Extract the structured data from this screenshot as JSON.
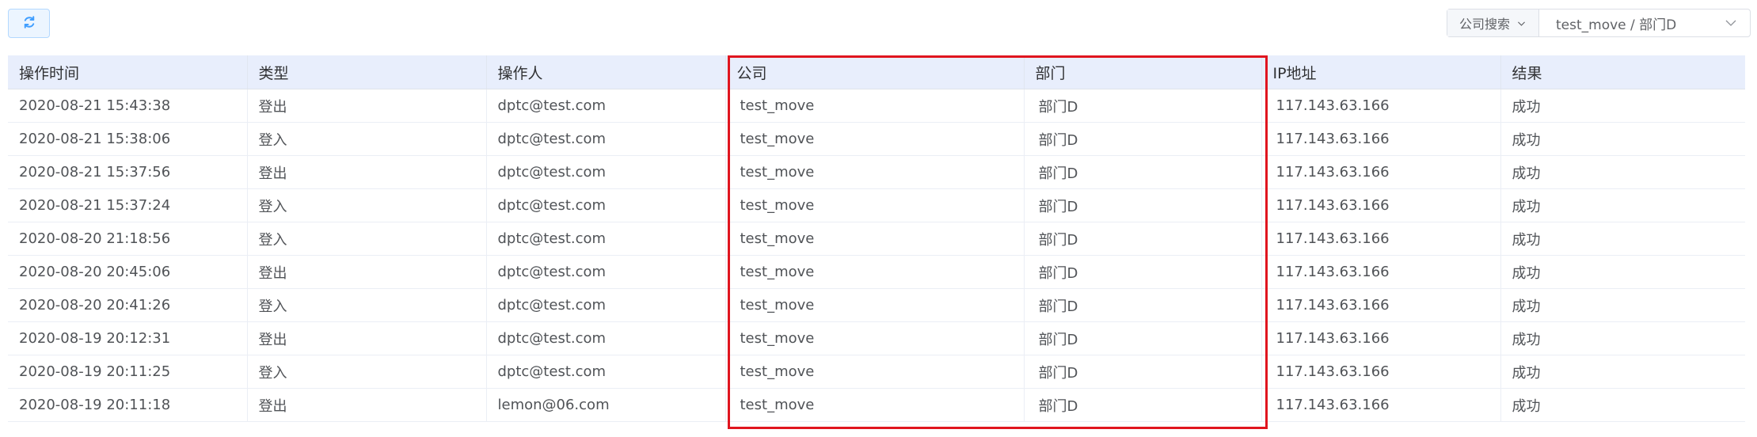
{
  "toolbar": {
    "refresh_icon": "refresh-icon",
    "search_mode_label": "公司搜索",
    "search_value": "test_move / 部门D",
    "chevron_icon": "chevron-down-icon"
  },
  "table": {
    "columns": [
      "操作时间",
      "类型",
      "操作人",
      "公司",
      "部门",
      "IP地址",
      "结果"
    ],
    "rows": [
      [
        "2020-08-21 15:43:38",
        "登出",
        "dptc@test.com",
        "test_move",
        "部门D",
        "117.143.63.166",
        "成功"
      ],
      [
        "2020-08-21 15:38:06",
        "登入",
        "dptc@test.com",
        "test_move",
        "部门D",
        "117.143.63.166",
        "成功"
      ],
      [
        "2020-08-21 15:37:56",
        "登出",
        "dptc@test.com",
        "test_move",
        "部门D",
        "117.143.63.166",
        "成功"
      ],
      [
        "2020-08-21 15:37:24",
        "登入",
        "dptc@test.com",
        "test_move",
        "部门D",
        "117.143.63.166",
        "成功"
      ],
      [
        "2020-08-20 21:18:56",
        "登入",
        "dptc@test.com",
        "test_move",
        "部门D",
        "117.143.63.166",
        "成功"
      ],
      [
        "2020-08-20 20:45:06",
        "登出",
        "dptc@test.com",
        "test_move",
        "部门D",
        "117.143.63.166",
        "成功"
      ],
      [
        "2020-08-20 20:41:26",
        "登入",
        "dptc@test.com",
        "test_move",
        "部门D",
        "117.143.63.166",
        "成功"
      ],
      [
        "2020-08-19 20:12:31",
        "登出",
        "dptc@test.com",
        "test_move",
        "部门D",
        "117.143.63.166",
        "成功"
      ],
      [
        "2020-08-19 20:11:25",
        "登入",
        "dptc@test.com",
        "test_move",
        "部门D",
        "117.143.63.166",
        "成功"
      ],
      [
        "2020-08-19 20:11:18",
        "登出",
        "lemon@06.com",
        "test_move",
        "部门D",
        "117.143.63.166",
        "成功"
      ]
    ]
  },
  "colors": {
    "accent": "#409eff",
    "header_bg": "#e8eefc",
    "highlight_border": "#e0151f"
  }
}
